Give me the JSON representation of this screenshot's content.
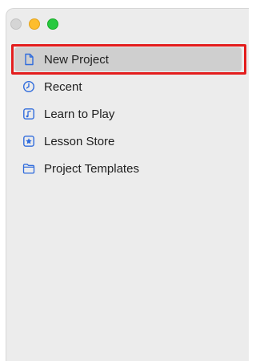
{
  "window": {
    "traffic_lights": [
      "close",
      "minimize",
      "zoom"
    ]
  },
  "sidebar": {
    "accent_color": "#2f6bdc",
    "selected_index": 0,
    "items": [
      {
        "label": "New Project",
        "icon": "new-document-icon"
      },
      {
        "label": "Recent",
        "icon": "clock-icon"
      },
      {
        "label": "Learn to Play",
        "icon": "music-note-icon"
      },
      {
        "label": "Lesson Store",
        "icon": "star-box-icon"
      },
      {
        "label": "Project Templates",
        "icon": "folder-icon"
      }
    ]
  }
}
